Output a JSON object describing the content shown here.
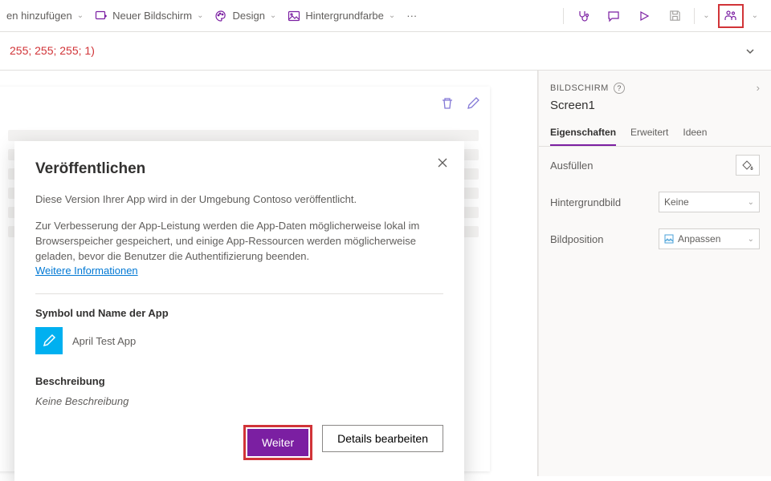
{
  "toolbar": {
    "add_label": "en hinzufügen",
    "new_screen_label": "Neuer Bildschirm",
    "design_label": "Design",
    "bgcolor_label": "Hintergrundfarbe",
    "more_label": "···"
  },
  "formula": {
    "expr": "255;  255;  255;  1)"
  },
  "panel": {
    "header_label": "BILDSCHIRM",
    "screen_name": "Screen1",
    "tab_props": "Eigenschaften",
    "tab_adv": "Erweitert",
    "tab_ideas": "Ideen",
    "prop_fill": "Ausfüllen",
    "prop_bgimage": "Hintergrundbild",
    "prop_bgimage_val": "Keine",
    "prop_imgpos": "Bildposition",
    "prop_imgpos_val": "Anpassen"
  },
  "dialog": {
    "title": "Veröffentlichen",
    "body1": "Diese Version Ihrer App wird in der Umgebung Contoso veröffentlicht.",
    "body2": "Zur Verbesserung der App-Leistung werden die App-Daten möglicherweise lokal im Browserspeicher gespeichert, und einige App-Ressourcen werden möglicherweise geladen, bevor die Benutzer die Authentifizierung beenden.",
    "link": "Weitere Informationen",
    "section_icon": "Symbol und Name der App",
    "app_name": "April Test App",
    "section_desc": "Beschreibung",
    "desc_value": "Keine Beschreibung",
    "btn_next": "Weiter",
    "btn_details": "Details bearbeiten"
  },
  "colors": {
    "accent": "#7b1fa2",
    "danger": "#d13438"
  }
}
